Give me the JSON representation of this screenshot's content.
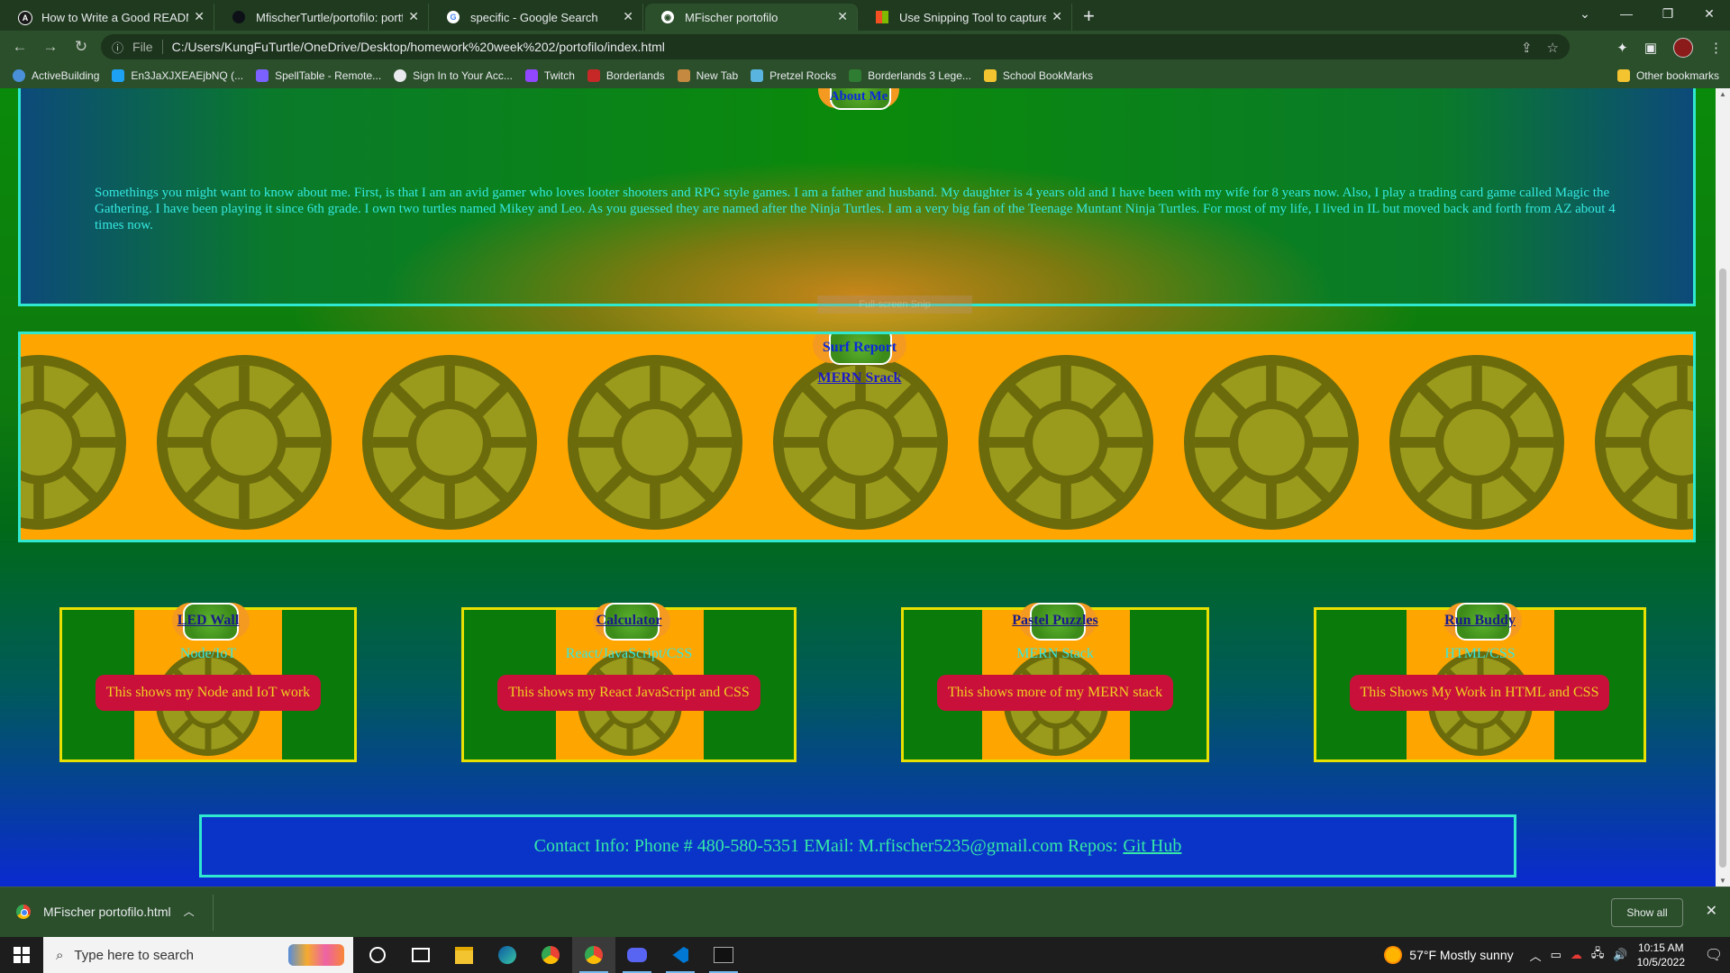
{
  "browser": {
    "tabs": [
      {
        "title": "How to Write a Good README F",
        "favicon": "A",
        "favicon_color": "#1a1a1a",
        "active": false
      },
      {
        "title": "MfischerTurtle/portofilo: portfolio",
        "favicon": "",
        "favicon_color": "#0d1117",
        "active": false
      },
      {
        "title": "specific - Google Search",
        "favicon": "G",
        "favicon_color": "#ffffff",
        "active": false
      },
      {
        "title": "MFischer portofilo",
        "favicon": "◉",
        "favicon_color": "#ffffff",
        "active": true
      },
      {
        "title": "Use Snipping Tool to capture scr",
        "favicon": "",
        "favicon_color": "#f25022",
        "active": false
      }
    ],
    "new_tab": "+",
    "address": {
      "protocol": "File",
      "url": "C:/Users/KungFuTurtle/OneDrive/Desktop/homework%20week%202/portofilo/index.html"
    },
    "bookmarks": [
      {
        "label": "ActiveBuilding",
        "color": "#4a90d9"
      },
      {
        "label": "En3JaXJXEAEjbNQ (...",
        "color": "#1da1f2"
      },
      {
        "label": "SpellTable - Remote...",
        "color": "#7b61ff"
      },
      {
        "label": "Sign In to Your Acc...",
        "color": "#e8eaed"
      },
      {
        "label": "Twitch",
        "color": "#9146ff"
      },
      {
        "label": "Borderlands",
        "color": "#c62828"
      },
      {
        "label": "New Tab",
        "color": "#c58a40"
      },
      {
        "label": "Pretzel Rocks",
        "color": "#5ab4e0"
      },
      {
        "label": "Borderlands 3 Lege...",
        "color": "#2e7d32"
      },
      {
        "label": "School BookMarks",
        "color": "#f4c430"
      }
    ],
    "other_bookmarks": "Other bookmarks"
  },
  "page": {
    "about": {
      "badge": "About Me",
      "text": "Somethings you might want to know about me. First, is that I am an avid gamer who loves looter shooters and RPG style games. I am a father and husband. My daughter is 4 years old and I have been with my wife for 8 years now. Also, I play a trading card game called Magic the Gathering. I have been playing it since 6th grade. I own two turtles named Mikey and Leo. As you guessed they are named after the Ninja Turtles. I am a very big fan of the Teenage Muntant Ninja Turtles. For most of my life, I lived in IL but moved back and forth from AZ about 4 times now."
    },
    "snip_hint": "Full-screen Snip",
    "surf": {
      "title": "Surf Report",
      "subtitle": "MERN Srack"
    },
    "projects": [
      {
        "title": "LED Wall",
        "tech": "Node/IoT",
        "button": "This shows my Node and IoT work"
      },
      {
        "title": "Calculator",
        "tech": "React/JavaScript/CSS",
        "button": "This shows my React JavaScript and CSS"
      },
      {
        "title": "Pastel Puzzles",
        "tech": "MERN Stack",
        "button": "This shows more of my MERN stack"
      },
      {
        "title": "Run Buddy",
        "tech": "HTML/CSS",
        "button": "This Shows My Work in HTML and CSS"
      }
    ],
    "contact": {
      "text": "Contact Info: Phone # 480-580-5351 EMail: M.rfischer5235@gmail.com Repos:",
      "link": "Git Hub"
    }
  },
  "downloads": {
    "file": "MFischer portofilo.html",
    "show_all": "Show all"
  },
  "taskbar": {
    "search_placeholder": "Type here to search",
    "weather": "57°F  Mostly sunny",
    "time": "10:15 AM",
    "date": "10/5/2022"
  },
  "colors": {
    "accent_cyan": "#2ee8d0",
    "banner_orange": "#ffa500",
    "button_red": "#c8103a",
    "card_border_yellow": "#e8e000"
  }
}
